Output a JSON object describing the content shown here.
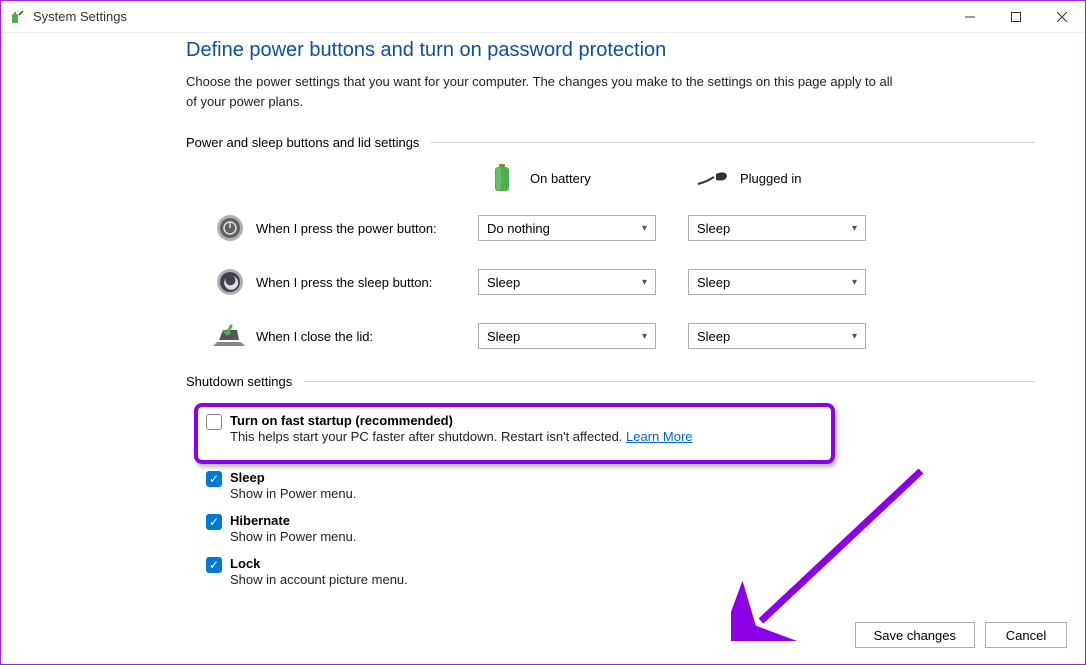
{
  "window": {
    "title": "System Settings"
  },
  "page": {
    "heading": "Define power buttons and turn on password protection",
    "description": "Choose the power settings that you want for your computer. The changes you make to the settings on this page apply to all of your power plans."
  },
  "powerSection": {
    "header": "Power and sleep buttons and lid settings",
    "columns": {
      "battery": "On battery",
      "plugged": "Plugged in"
    },
    "rows": {
      "power": {
        "label": "When I press the power button:",
        "battery": "Do nothing",
        "plugged": "Sleep"
      },
      "sleep": {
        "label": "When I press the sleep button:",
        "battery": "Sleep",
        "plugged": "Sleep"
      },
      "lid": {
        "label": "When I close the lid:",
        "battery": "Sleep",
        "plugged": "Sleep"
      }
    }
  },
  "shutdownSection": {
    "header": "Shutdown settings",
    "items": {
      "fastStartup": {
        "label": "Turn on fast startup (recommended)",
        "desc": "This helps start your PC faster after shutdown. Restart isn't affected. ",
        "learnMore": "Learn More"
      },
      "sleep": {
        "label": "Sleep",
        "desc": "Show in Power menu."
      },
      "hibernate": {
        "label": "Hibernate",
        "desc": "Show in Power menu."
      },
      "lock": {
        "label": "Lock",
        "desc": "Show in account picture menu."
      }
    }
  },
  "buttons": {
    "save": "Save changes",
    "cancel": "Cancel"
  }
}
